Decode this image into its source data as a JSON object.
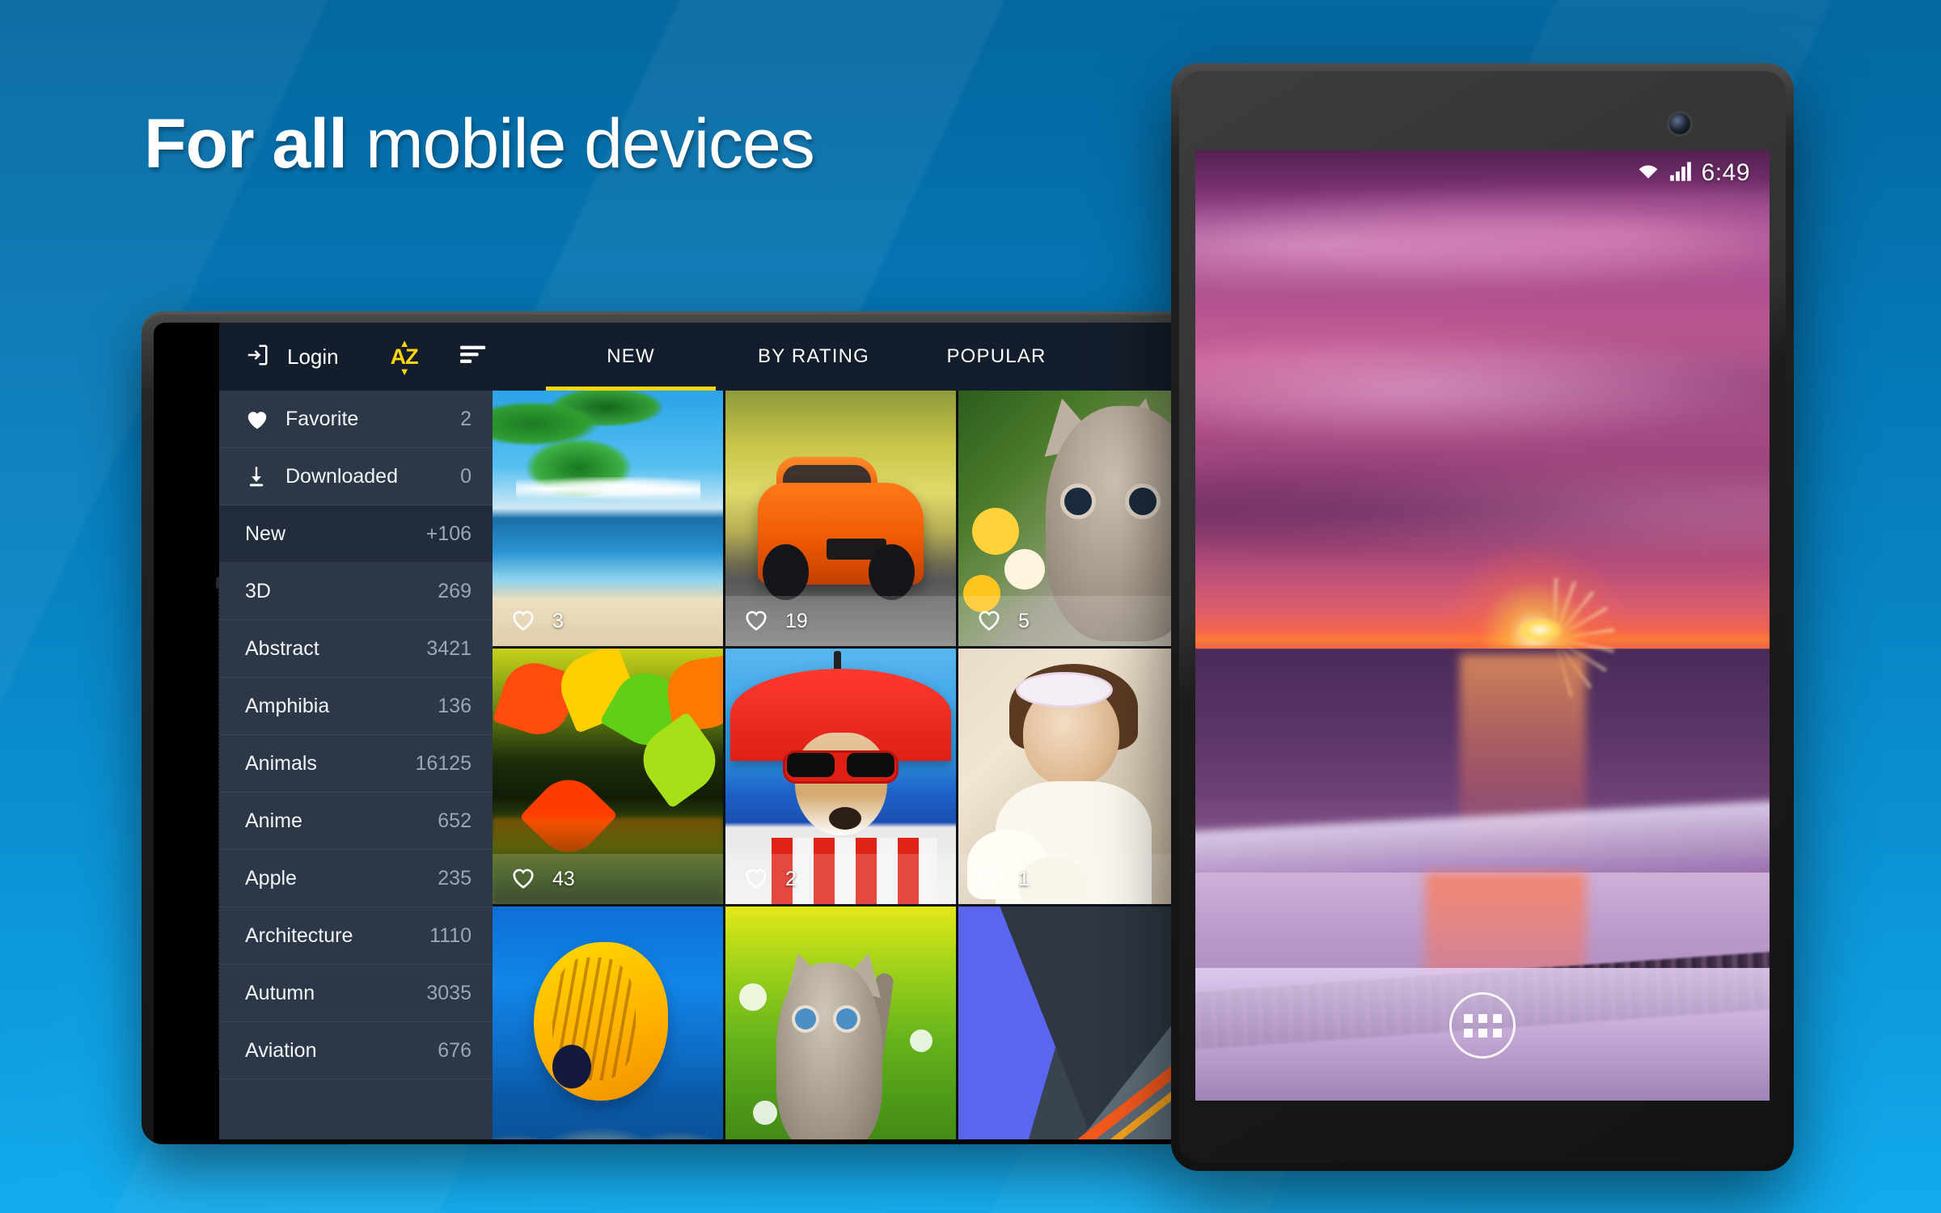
{
  "headline": {
    "bold": "For all",
    "regular": " mobile devices"
  },
  "colors": {
    "background_blue": "#0678b4",
    "accent_yellow": "#ffd60a",
    "appbar": "#141d2b",
    "sidebar": "#2c3747",
    "sidebar_highlight": "#232c3a"
  },
  "tablet": {
    "appbar": {
      "login_label": "Login",
      "login_icon": "login-arrow-icon",
      "sort_az_label": "AZ",
      "sort_az_icon": "sort-alphabetical-icon",
      "filter_icon": "sort-lines-icon"
    },
    "tabs": [
      {
        "label": "NEW",
        "active": true
      },
      {
        "label": "BY RATING",
        "active": false
      },
      {
        "label": "POPULAR",
        "active": false
      }
    ],
    "sidebar": {
      "pinned": [
        {
          "label": "Favorite",
          "count": "2",
          "icon": "heart-icon"
        },
        {
          "label": "Downloaded",
          "count": "0",
          "icon": "download-icon"
        }
      ],
      "categories": [
        {
          "label": "New",
          "count": "+106",
          "highlighted": true
        },
        {
          "label": "3D",
          "count": "269",
          "highlighted": false
        },
        {
          "label": "Abstract",
          "count": "3421",
          "highlighted": false
        },
        {
          "label": "Amphibia",
          "count": "136",
          "highlighted": false
        },
        {
          "label": "Animals",
          "count": "16125",
          "highlighted": false
        },
        {
          "label": "Anime",
          "count": "652",
          "highlighted": false
        },
        {
          "label": "Apple",
          "count": "235",
          "highlighted": false
        },
        {
          "label": "Architecture",
          "count": "1110",
          "highlighted": false
        },
        {
          "label": "Autumn",
          "count": "3035",
          "highlighted": false
        },
        {
          "label": "Aviation",
          "count": "676",
          "highlighted": false
        }
      ]
    },
    "grid": [
      {
        "art": "art-beach",
        "likes": "3",
        "alt": "tropical beach with palm"
      },
      {
        "art": "art-car",
        "likes": "19",
        "alt": "orange sports car"
      },
      {
        "art": "art-kit1",
        "likes": "5",
        "alt": "kitten with flowers"
      },
      {
        "art": "art-leaf",
        "likes": "43",
        "alt": "autumn maple leaves"
      },
      {
        "art": "art-dog",
        "likes": "2",
        "alt": "dog with sunglasses under red umbrella"
      },
      {
        "art": "art-girl",
        "likes": "1",
        "alt": "girl with flower headband"
      },
      {
        "art": "art-fish",
        "likes": "",
        "alt": "yellow butterfly fish on reef"
      },
      {
        "art": "art-kit2",
        "likes": "",
        "alt": "kitten in grass"
      },
      {
        "art": "art-mat",
        "likes": "",
        "alt": "abstract material design"
      }
    ]
  },
  "phone": {
    "status": {
      "time": "6:49",
      "wifi_icon": "wifi-icon",
      "signal_icon": "signal-bars-icon"
    },
    "home": {
      "drawer_icon": "app-drawer-icon"
    },
    "wallpaper_alt": "purple sunset over ocean beach"
  }
}
